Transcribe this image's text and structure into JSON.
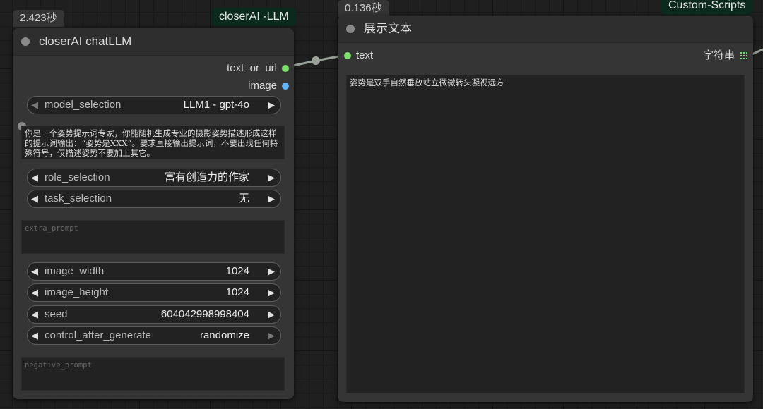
{
  "left_node": {
    "timing": "2.423秒",
    "badge": "closerAI -LLM",
    "title": "closerAI chatLLM",
    "outputs": [
      {
        "label": "text_or_url",
        "color": "#7fdc6f"
      },
      {
        "label": "image",
        "color": "#64b5f6"
      }
    ],
    "model_selection": {
      "label": "model_selection",
      "value": "LLM1 - gpt-4o"
    },
    "system_prompt": "你是一个姿势提示词专家，你能随机生成专业的摄影姿势描述形成这样的提示词输出：“姿势是XXX”。要求直接输出提示词，不要出现任何特殊符号，仅描述姿势不要加上其它。",
    "role_selection": {
      "label": "role_selection",
      "value": "富有创造力的作家"
    },
    "task_selection": {
      "label": "task_selection",
      "value": "无"
    },
    "extra_prompt_placeholder": "extra_prompt",
    "image_width": {
      "label": "image_width",
      "value": "1024"
    },
    "image_height": {
      "label": "image_height",
      "value": "1024"
    },
    "seed": {
      "label": "seed",
      "value": "604042998998404"
    },
    "control_after_generate": {
      "label": "control_after_generate",
      "value": "randomize"
    },
    "negative_prompt_placeholder": "negative_prompt"
  },
  "right_node": {
    "timing": "0.136秒",
    "badge": "Custom-Scripts",
    "title": "展示文本",
    "input_label": "text",
    "output_label": "字符串",
    "display_text": "姿势是双手自然垂放站立微微转头凝视远方"
  },
  "colors": {
    "link": "#9aa39a",
    "text_socket": "#7fdc6f",
    "image_socket": "#64b5f6",
    "badge_bg": "#0b2a1d"
  }
}
